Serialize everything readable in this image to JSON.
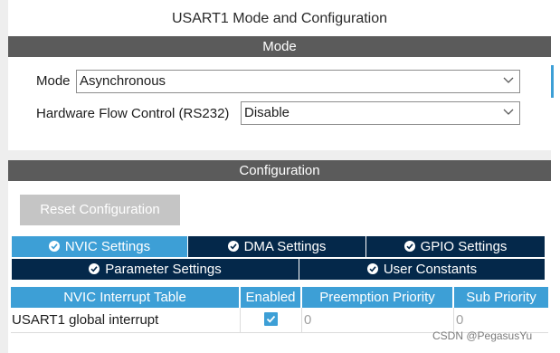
{
  "window": {
    "title": "USART1 Mode and Configuration"
  },
  "mode_section": {
    "header": "Mode",
    "fields": [
      {
        "label": "Mode",
        "value": "Asynchronous"
      },
      {
        "label": "Hardware Flow Control (RS232)",
        "value": "Disable"
      }
    ]
  },
  "config_section": {
    "header": "Configuration",
    "reset_label": "Reset Configuration",
    "tabs": [
      {
        "label": "NVIC Settings",
        "active": true
      },
      {
        "label": "DMA Settings"
      },
      {
        "label": "GPIO Settings"
      },
      {
        "label": "Parameter Settings"
      },
      {
        "label": "User Constants"
      }
    ],
    "nvic_table": {
      "headers": [
        "NVIC Interrupt Table",
        "Enabled",
        "Preemption Priority",
        "Sub Priority"
      ],
      "rows": [
        {
          "name": "USART1 global interrupt",
          "enabled": true,
          "preemption": "0",
          "sub": "0"
        }
      ]
    }
  },
  "watermark": "CSDN @PegasusYu",
  "colors": {
    "accent": "#3d9fd6",
    "tab_dark": "#04284a",
    "section_bar": "#5b5b5b",
    "reset_button": "#c5c5c5"
  }
}
